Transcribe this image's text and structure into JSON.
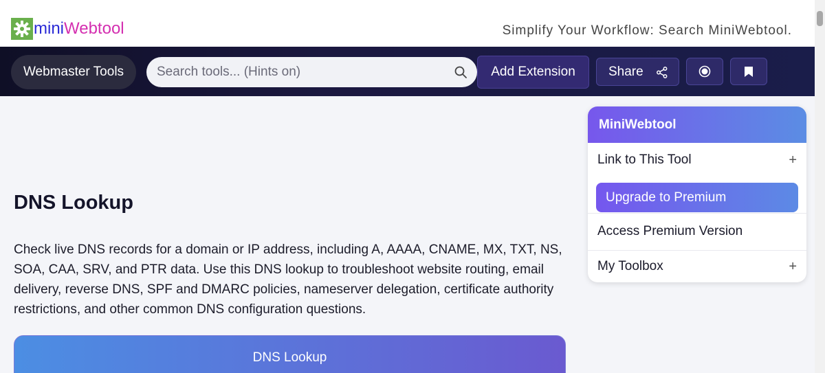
{
  "header": {
    "logo_mini": "mini",
    "logo_web": "Webtool",
    "tagline": "Simplify Your Workflow: Search MiniWebtool."
  },
  "nav": {
    "category_label": "Webmaster Tools",
    "search_placeholder": "Search tools... (Hints on)",
    "add_extension_label": "Add Extension",
    "share_label": "Share",
    "icons": [
      "search-icon",
      "share-icon",
      "record-icon",
      "bookmark-icon"
    ]
  },
  "main": {
    "title": "DNS Lookup",
    "description": "Check live DNS records for a domain or IP address, including A, AAAA, CNAME, MX, TXT, NS, SOA, CAA, SRV, and PTR data. Use this DNS lookup to troubleshoot website routing, email delivery, reverse DNS, SPF and DMARC policies, nameserver delegation, certificate authority restrictions, and other common DNS configuration questions.",
    "tool_card_title": "DNS Lookup"
  },
  "panel": {
    "title": "MiniWebtool",
    "link_label": "Link to This Tool",
    "upgrade_label": "Upgrade to Premium",
    "premium_label": "Access Premium Version",
    "toolbox_label": "My Toolbox",
    "plus_symbol": "+"
  },
  "colors": {
    "accent_purple": "#7757ec",
    "accent_blue": "#5b8de4",
    "nav_dark": "#0f0f26",
    "logo_green": "#6ab04c",
    "logo_blue": "#2b2bd6",
    "logo_pink": "#d42fb0"
  }
}
